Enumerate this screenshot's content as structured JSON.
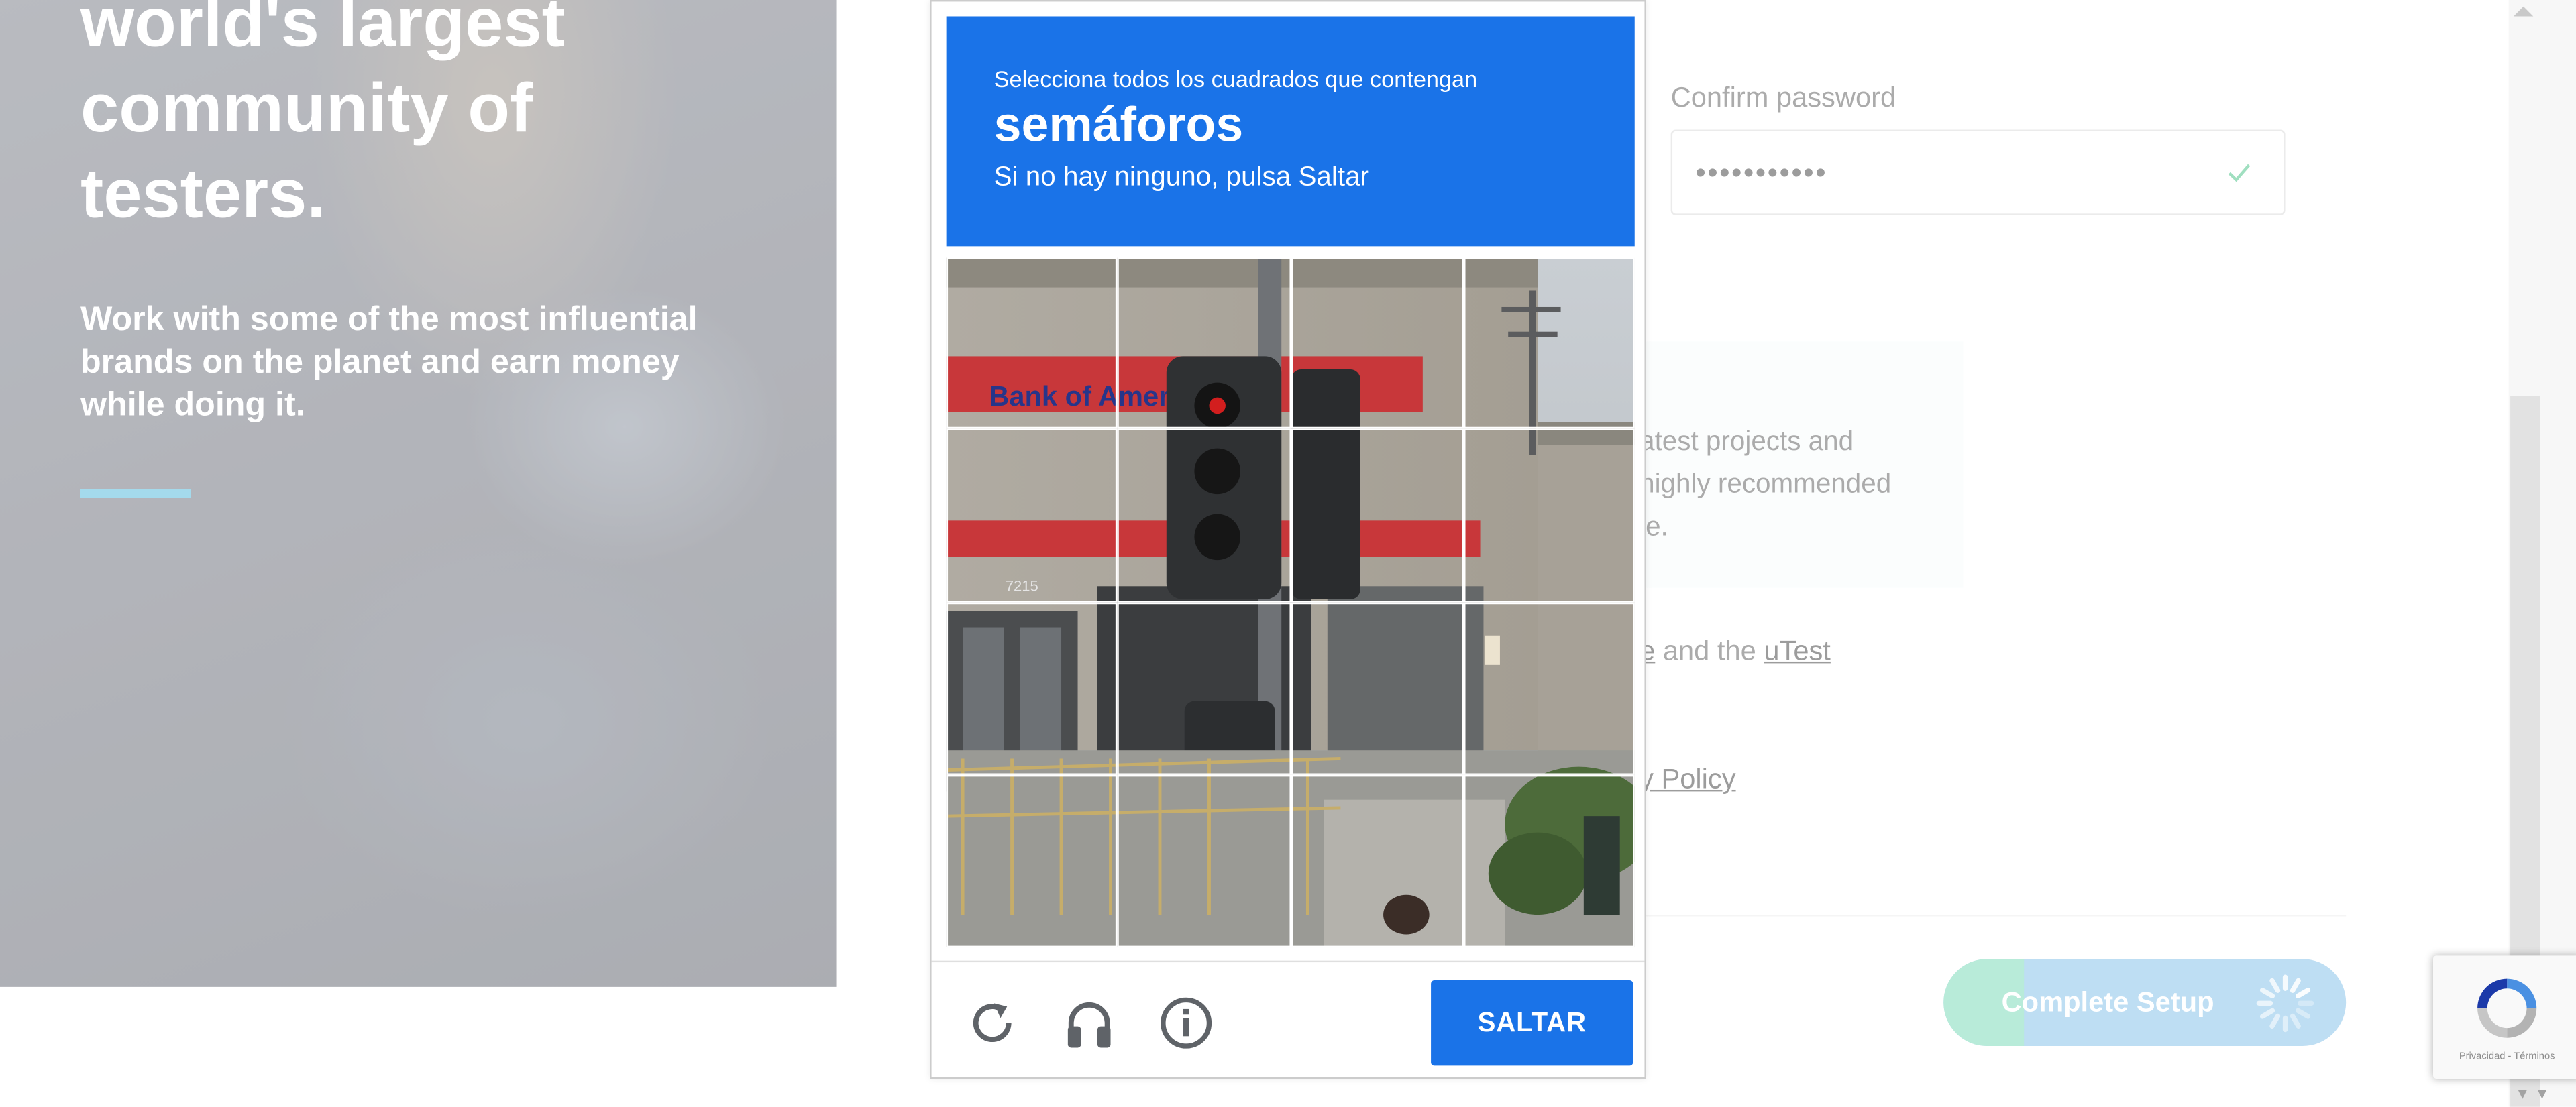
{
  "hero": {
    "headline": "world's largest\ncommunity of\ntesters.",
    "subtext": "Work with some of the most influential brands on the planet and earn money while doing it."
  },
  "form": {
    "confirm_password_label": "Confirm password",
    "confirm_password_value": "•••••••••••",
    "info_text": "atest projects and\nhighly recommended\nle.",
    "terms_link_fragment": "e",
    "terms_connector": " and the ",
    "terms_link_utest": "uTest",
    "privacy_fragment": "y Policy",
    "complete_button_label": "Complete Setup",
    "complete_progress_fraction": 0.2
  },
  "captcha": {
    "instruction": "Selecciona todos los cuadrados que contengan",
    "keyword": "semáforos",
    "hint": "Si no hay ninguno, pulsa Saltar",
    "skip_label": "SALTAR",
    "grid_rows": 4,
    "grid_cols": 4,
    "controls": [
      "reload-icon",
      "audio-headphones-icon",
      "info-icon"
    ],
    "scene_text": {
      "bank_sign": "Bank of Amer",
      "address": "7215"
    }
  },
  "recaptcha_badge": {
    "fine_print": "Privacidad - Términos"
  },
  "colors": {
    "captcha_blue": "#1a73e8",
    "accent_line": "#62c0de",
    "button_fill": "#8fc6ea",
    "button_progress": "#86dcbe",
    "check_green": "#5cc993"
  }
}
